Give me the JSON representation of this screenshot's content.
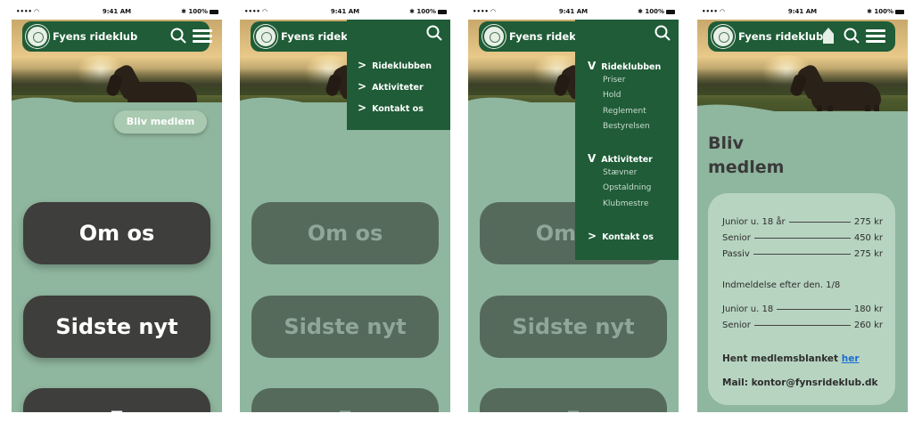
{
  "status": {
    "signal": "•••• ◠",
    "time": "9:41 AM",
    "battery": "✱ 100%"
  },
  "brand": {
    "name": "Fyens rideklub",
    "name_truncated": "Fyens ridekl"
  },
  "home": {
    "join_button": "Bliv medlem",
    "buttons": [
      "Om os",
      "Sidste nyt",
      "F"
    ]
  },
  "menu_collapsed": {
    "items": [
      "Rideklubben",
      "Aktiviteter",
      "Kontakt os"
    ],
    "arrow": ">"
  },
  "menu_expanded": {
    "open_arrow": "V",
    "closed_arrow": ">",
    "sections": [
      {
        "label": "Rideklubben",
        "children": [
          "Priser",
          "Hold",
          "Reglement",
          "Bestyrelsen"
        ]
      },
      {
        "label": "Aktiviteter",
        "children": [
          "Stævner",
          "Opstaldning",
          "Klubmestre"
        ]
      }
    ],
    "contact": "Kontakt os"
  },
  "membership": {
    "title_line1": "Bliv",
    "title_line2": "medlem",
    "prices": [
      {
        "label": "Junior u. 18 år",
        "value": "275 kr"
      },
      {
        "label": "Senior",
        "value": "450 kr"
      },
      {
        "label": "Passiv",
        "value": "275 kr"
      }
    ],
    "late_note": "Indmeldelse efter den. 1/8",
    "late_prices": [
      {
        "label": "Junior u. 18",
        "value": "180 kr"
      },
      {
        "label": "Senior",
        "value": "260 kr"
      }
    ],
    "form_text": "Hent medlemsblanket",
    "form_link": "her",
    "mail": "Mail: kontor@fynsrideklub.dk"
  },
  "colors": {
    "nav": "#1f5c37",
    "bg": "#8fb69e",
    "button": "#3e3e3c",
    "card": "#b7d4c0",
    "link": "#1a6dd8"
  },
  "icons": [
    "club-logo-icon",
    "search-icon",
    "hamburger-menu-icon",
    "home-icon"
  ]
}
